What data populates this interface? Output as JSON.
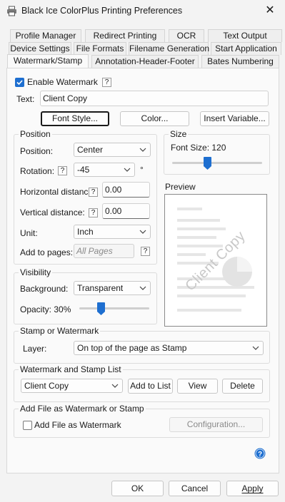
{
  "window": {
    "title": "Black Ice ColorPlus Printing Preferences",
    "close": "✕"
  },
  "tabs": {
    "row1": [
      "Profile Manager",
      "Redirect Printing",
      "OCR",
      "Text Output"
    ],
    "row2": [
      "Device Settings",
      "File Formats",
      "Filename Generation",
      "Start Application"
    ],
    "row3": [
      "Watermark/Stamp",
      "Annotation-Header-Footer",
      "Bates Numbering"
    ],
    "active": "Watermark/Stamp"
  },
  "watermark": {
    "enable_label": "Enable Watermark",
    "enable_checked": true,
    "help": "?",
    "text_label": "Text:",
    "text_value": "Client Copy",
    "font_style_button": "Font Style...",
    "color_button": "Color...",
    "insert_variable_button": "Insert Variable..."
  },
  "position": {
    "title": "Position",
    "position_label": "Position:",
    "position_value": "Center",
    "rotation_label": "Rotation:",
    "rotation_value": "-45",
    "rotation_unit": "°",
    "hdist_label": "Horizontal distance:",
    "hdist_value": "0.00",
    "vdist_label": "Vertical distance:",
    "vdist_value": "0.00",
    "unit_label": "Unit:",
    "unit_value": "Inch",
    "add_pages_label": "Add to pages:",
    "add_pages_value": "All Pages",
    "help": "?"
  },
  "size": {
    "title": "Size",
    "font_size_label": "Font Size: 120",
    "font_size_level": 0.5
  },
  "preview": {
    "title": "Preview",
    "watermark_text": "Client Copy"
  },
  "visibility": {
    "title": "Visibility",
    "background_label": "Background:",
    "background_value": "Transparent",
    "opacity_label": "Opacity: 30%",
    "opacity_level": 0.3
  },
  "stamp": {
    "title": "Stamp or Watermark",
    "layer_label": "Layer:",
    "layer_value": "On top of the page as Stamp"
  },
  "list": {
    "title": "Watermark and Stamp List",
    "selected": "Client Copy",
    "add_button": "Add to List",
    "view_button": "View",
    "delete_button": "Delete"
  },
  "file_wm": {
    "title": "Add File as Watermark or Stamp",
    "checkbox_label": "Add File as Watermark",
    "checked": false,
    "config_button": "Configuration..."
  },
  "footer": {
    "ok": "OK",
    "cancel": "Cancel",
    "apply": "Apply"
  },
  "colors": {
    "accent": "#1e6fd0",
    "preview_text": "#c8c8c8"
  }
}
